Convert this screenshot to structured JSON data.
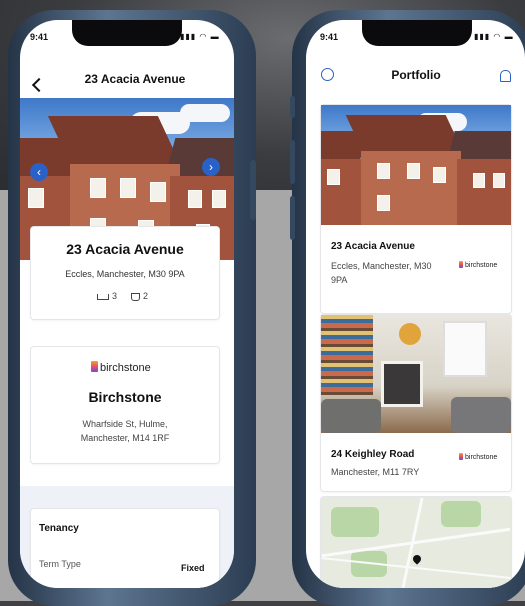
{
  "left_phone": {
    "status_time": "9:41",
    "status_icons": "▮▮▮ ◠ ▬",
    "header_title": "23 Acacia Avenue",
    "property": {
      "name": "23 Acacia Avenue",
      "address": "Eccles, Manchester, M30 9PA",
      "bedrooms": "3",
      "bathrooms": "2"
    },
    "agent": {
      "brand": "birchstone",
      "name": "Birchstone",
      "address_line1": "Wharfside St, Hulme,",
      "address_line2": "Manchester, M14 1RF"
    },
    "tenancy": {
      "title": "Tenancy",
      "term_type_label": "Term Type",
      "term_type_value": "Fixed"
    }
  },
  "right_phone": {
    "status_time": "9:41",
    "status_icons": "▮▮▮ ◠ ▬",
    "header_title": "Portfolio",
    "properties": [
      {
        "name": "23 Acacia Avenue",
        "address_line1": "Eccles, Manchester, M30",
        "address_line2": "9PA",
        "brand": "birchstone"
      },
      {
        "name": "24 Keighley Road",
        "address_line1": "Manchester, M11 7RY",
        "brand": "birchstone"
      }
    ]
  },
  "colors": {
    "accent": "#2a61c7",
    "brick": "#a2533d"
  },
  "icons": [
    "back-arrow-icon",
    "chevron-left-icon",
    "chevron-right-icon",
    "bed-icon",
    "bath-icon",
    "profile-icon",
    "bell-icon",
    "map-pin-icon"
  ]
}
